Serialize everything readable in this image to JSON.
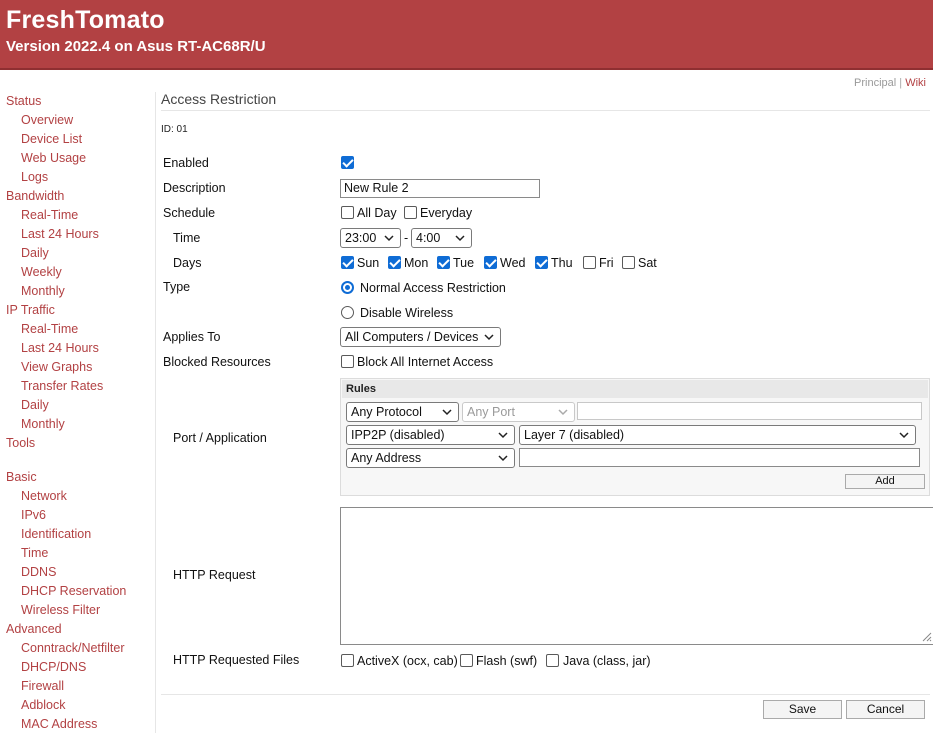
{
  "header": {
    "title": "FreshTomato",
    "subtitle": "Version 2022.4 on Asus RT-AC68R/U"
  },
  "toplinks": {
    "principal": "Principal",
    "separator": "|",
    "wiki": "Wiki"
  },
  "sidebar": {
    "items": [
      {
        "label": "Status",
        "level": "top"
      },
      {
        "label": "Overview",
        "level": "sub"
      },
      {
        "label": "Device List",
        "level": "sub"
      },
      {
        "label": "Web Usage",
        "level": "sub"
      },
      {
        "label": "Logs",
        "level": "sub"
      },
      {
        "label": "Bandwidth",
        "level": "top"
      },
      {
        "label": "Real-Time",
        "level": "sub"
      },
      {
        "label": "Last 24 Hours",
        "level": "sub"
      },
      {
        "label": "Daily",
        "level": "sub"
      },
      {
        "label": "Weekly",
        "level": "sub"
      },
      {
        "label": "Monthly",
        "level": "sub"
      },
      {
        "label": "IP Traffic",
        "level": "top"
      },
      {
        "label": "Real-Time",
        "level": "sub"
      },
      {
        "label": "Last 24 Hours",
        "level": "sub"
      },
      {
        "label": "View Graphs",
        "level": "sub"
      },
      {
        "label": "Transfer Rates",
        "level": "sub"
      },
      {
        "label": "Daily",
        "level": "sub"
      },
      {
        "label": "Monthly",
        "level": "sub"
      },
      {
        "label": "Tools",
        "level": "top"
      },
      {
        "label": "Basic",
        "level": "top"
      },
      {
        "label": "Network",
        "level": "sub"
      },
      {
        "label": "IPv6",
        "level": "sub"
      },
      {
        "label": "Identification",
        "level": "sub"
      },
      {
        "label": "Time",
        "level": "sub"
      },
      {
        "label": "DDNS",
        "level": "sub"
      },
      {
        "label": "DHCP Reservation",
        "level": "sub"
      },
      {
        "label": "Wireless Filter",
        "level": "sub"
      },
      {
        "label": "Advanced",
        "level": "top"
      },
      {
        "label": "Conntrack/Netfilter",
        "level": "sub"
      },
      {
        "label": "DHCP/DNS",
        "level": "sub"
      },
      {
        "label": "Firewall",
        "level": "sub"
      },
      {
        "label": "Adblock",
        "level": "sub"
      },
      {
        "label": "MAC Address",
        "level": "sub"
      }
    ]
  },
  "page": {
    "title": "Access Restriction",
    "id_text": "ID: 01"
  },
  "form": {
    "enabled": {
      "label": "Enabled",
      "checked": true
    },
    "description": {
      "label": "Description",
      "value": "New Rule 2"
    },
    "schedule": {
      "label": "Schedule",
      "all_day": {
        "label": "All Day",
        "checked": false
      },
      "everyday": {
        "label": "Everyday",
        "checked": false
      }
    },
    "time": {
      "label": "Time",
      "start": "23:00",
      "dash": "-",
      "end": "4:00"
    },
    "days": {
      "label": "Days",
      "items": [
        {
          "label": "Sun",
          "checked": true
        },
        {
          "label": "Mon",
          "checked": true
        },
        {
          "label": "Tue",
          "checked": true
        },
        {
          "label": "Wed",
          "checked": true
        },
        {
          "label": "Thu",
          "checked": true
        },
        {
          "label": "Fri",
          "checked": false
        },
        {
          "label": "Sat",
          "checked": false
        }
      ]
    },
    "type": {
      "label": "Type",
      "normal": {
        "label": "Normal Access Restriction",
        "selected": true
      },
      "disable_wireless": {
        "label": "Disable Wireless",
        "selected": false
      }
    },
    "applies_to": {
      "label": "Applies To",
      "value": "All Computers / Devices"
    },
    "blocked_resources": {
      "label": "Blocked Resources",
      "block_all": {
        "label": "Block All Internet Access",
        "checked": false
      }
    },
    "port_application": {
      "label": "Port / Application",
      "rules_header": "Rules",
      "protocol": "Any Protocol",
      "port": "Any Port",
      "port_value": "",
      "ipp2p": "IPP2P (disabled)",
      "layer7": "Layer 7 (disabled)",
      "address": "Any Address",
      "address_value": "",
      "add_label": "Add"
    },
    "http_request": {
      "label": "HTTP Request",
      "value": ""
    },
    "http_files": {
      "label": "HTTP Requested Files",
      "activex": {
        "label": "ActiveX (ocx, cab)",
        "checked": false
      },
      "flash": {
        "label": "Flash (swf)",
        "checked": false
      },
      "java": {
        "label": "Java (class, jar)",
        "checked": false
      }
    }
  },
  "actions": {
    "save": "Save",
    "cancel": "Cancel"
  },
  "colors": {
    "brand": "#b24143",
    "accent": "#0f6cd5"
  }
}
